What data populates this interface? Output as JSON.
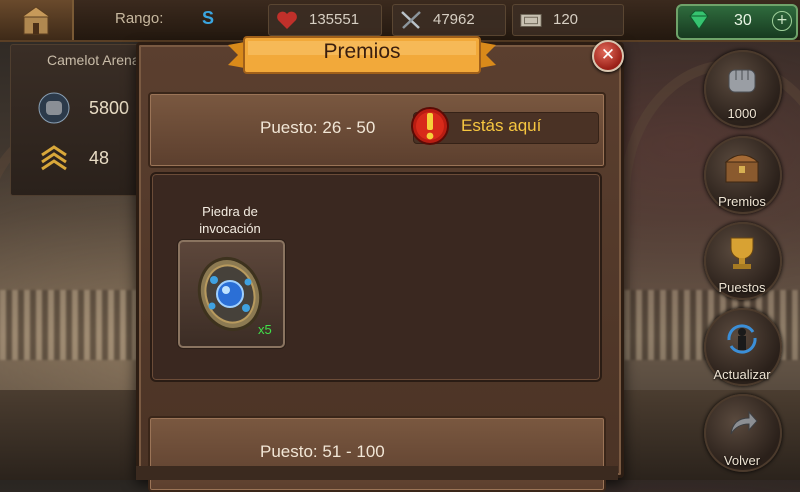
{
  "topbar": {
    "rango_label": "Rango:",
    "rango_value": "S",
    "health": "135551",
    "attack": "47962",
    "tickets": "120",
    "gems": "30"
  },
  "left_panel": {
    "title": "Camelot Arena",
    "power": "5800",
    "rank": "48"
  },
  "side_buttons": [
    {
      "label": "1000",
      "icon": "fist-icon"
    },
    {
      "label": "Premios",
      "icon": "chest-icon"
    },
    {
      "label": "Puestos",
      "icon": "trophy-icon"
    },
    {
      "label": "Actualizar",
      "icon": "refresh-icon"
    },
    {
      "label": "Volver",
      "icon": "back-arrow-icon"
    }
  ],
  "modal": {
    "title": "Premios",
    "tiers": [
      {
        "range": "Puesto: 26 - 50",
        "you_are_here": "Estás aquí",
        "rewards": [
          {
            "name": "Piedra de invocación",
            "quantity": "x5",
            "icon": "summoning-stone-icon"
          }
        ]
      },
      {
        "range": "Puesto: 51 - 100"
      }
    ]
  },
  "colors": {
    "accent_gold": "#f6c640",
    "rank_blue": "#3aa5e0",
    "quantity_green": "#40e04a"
  }
}
